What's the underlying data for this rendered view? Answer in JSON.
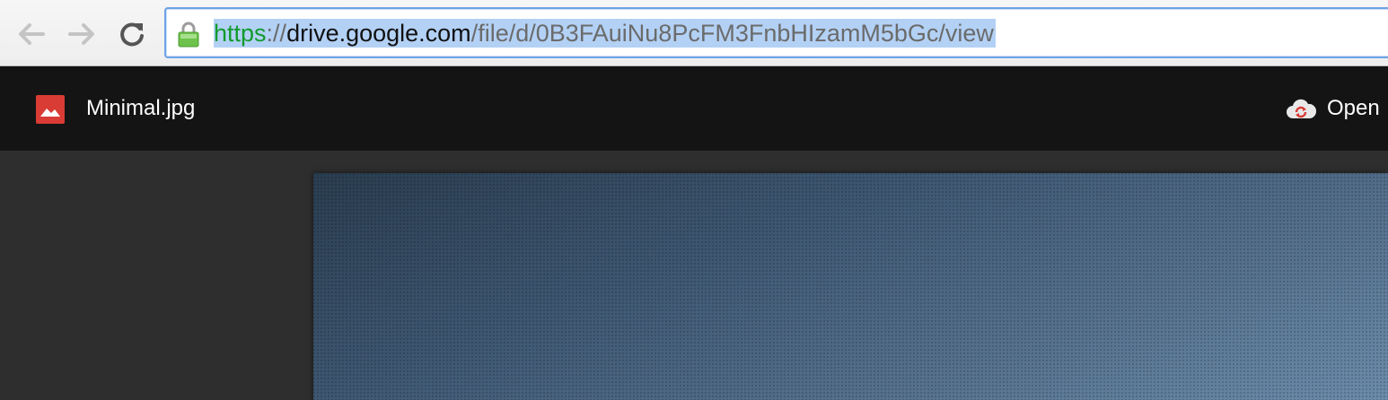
{
  "browser": {
    "back_icon": "back-arrow-icon",
    "forward_icon": "forward-arrow-icon",
    "reload_icon": "reload-icon",
    "lock_icon": "secure-lock-icon",
    "address": {
      "scheme": "https",
      "separator": "://",
      "host": "drive.google.com",
      "path": "/file/d/0B3FAuiNu8PcFM3FnbHIzamM5bGc/view"
    },
    "colors": {
      "scheme": "#119a2c",
      "selection": "#b3d1f5",
      "focus_border": "#6fa3e6"
    }
  },
  "viewer": {
    "file_icon": "image-file-icon",
    "file_name": "Minimal.jpg",
    "open_with": {
      "icon": "cloud-sync-icon",
      "label": "Open"
    },
    "colors": {
      "header_bg": "#141414",
      "body_bg": "#2e2e2e",
      "file_icon": "#d93b35"
    }
  }
}
